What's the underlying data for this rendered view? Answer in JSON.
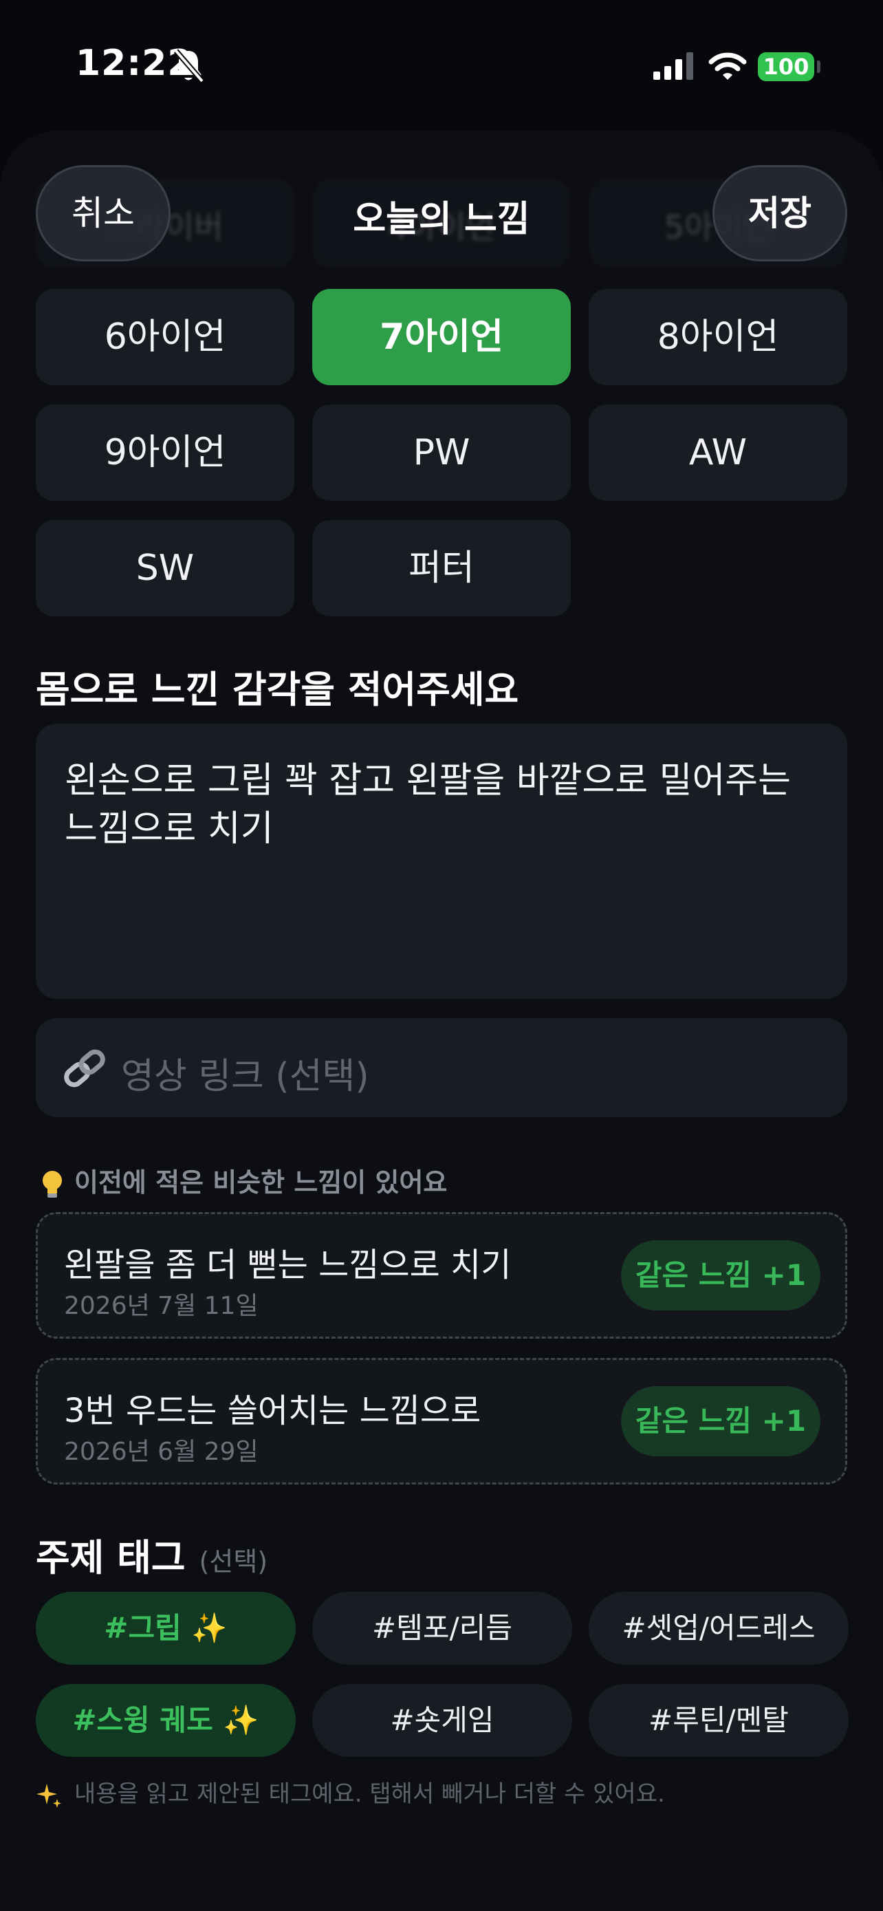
{
  "status_bar": {
    "time": "12:22",
    "battery": "100"
  },
  "header": {
    "cancel_label": "취소",
    "title": "오늘의 느낌",
    "save_label": "저장"
  },
  "hidden_clubs": [
    "드라이버",
    "4아이언",
    "5아이언"
  ],
  "clubs": [
    {
      "label": "6아이언",
      "selected": false
    },
    {
      "label": "7아이언",
      "selected": true
    },
    {
      "label": "8아이언",
      "selected": false
    },
    {
      "label": "9아이언",
      "selected": false
    },
    {
      "label": "PW",
      "selected": false
    },
    {
      "label": "AW",
      "selected": false
    },
    {
      "label": "SW",
      "selected": false
    },
    {
      "label": "퍼터",
      "selected": false
    }
  ],
  "feeling_section": {
    "title": "몸으로 느낀 감각을 적어주세요",
    "value": "왼손으로 그립 꽉 잡고 왼팔을 바깥으로 밀어주는 느낌으로 치기"
  },
  "video_link": {
    "placeholder": "영상 링크 (선택)",
    "icon": "link-icon"
  },
  "similar_hint": "이전에 적은 비슷한 느낌이 있어요",
  "similar_feelings": [
    {
      "text": "왼팔을 좀 더 뻗는 느낌으로 치기",
      "date": "2026년 7월 11일",
      "action": "같은 느낌 +1"
    },
    {
      "text": "3번 우드는 쓸어치는 느낌으로",
      "date": "2026년 6월 29일",
      "action": "같은 느낌 +1"
    }
  ],
  "tags_section": {
    "title": "주제 태그",
    "optional": "(선택)"
  },
  "tags": [
    {
      "label": "#그립 ✨",
      "selected": true
    },
    {
      "label": "#템포/리듬",
      "selected": false
    },
    {
      "label": "#셋업/어드레스",
      "selected": false
    },
    {
      "label": "#스윙 궤도 ✨",
      "selected": true
    },
    {
      "label": "#숏게임",
      "selected": false
    },
    {
      "label": "#루틴/멘탈",
      "selected": false
    }
  ],
  "footnote": "내용을 읽고 제안된 태그예요. 탭해서 빼거나 더할 수 있어요.",
  "colors": {
    "accent": "#2f9e48",
    "tag_selected_text": "#3cc05e",
    "background": "#07080b"
  }
}
